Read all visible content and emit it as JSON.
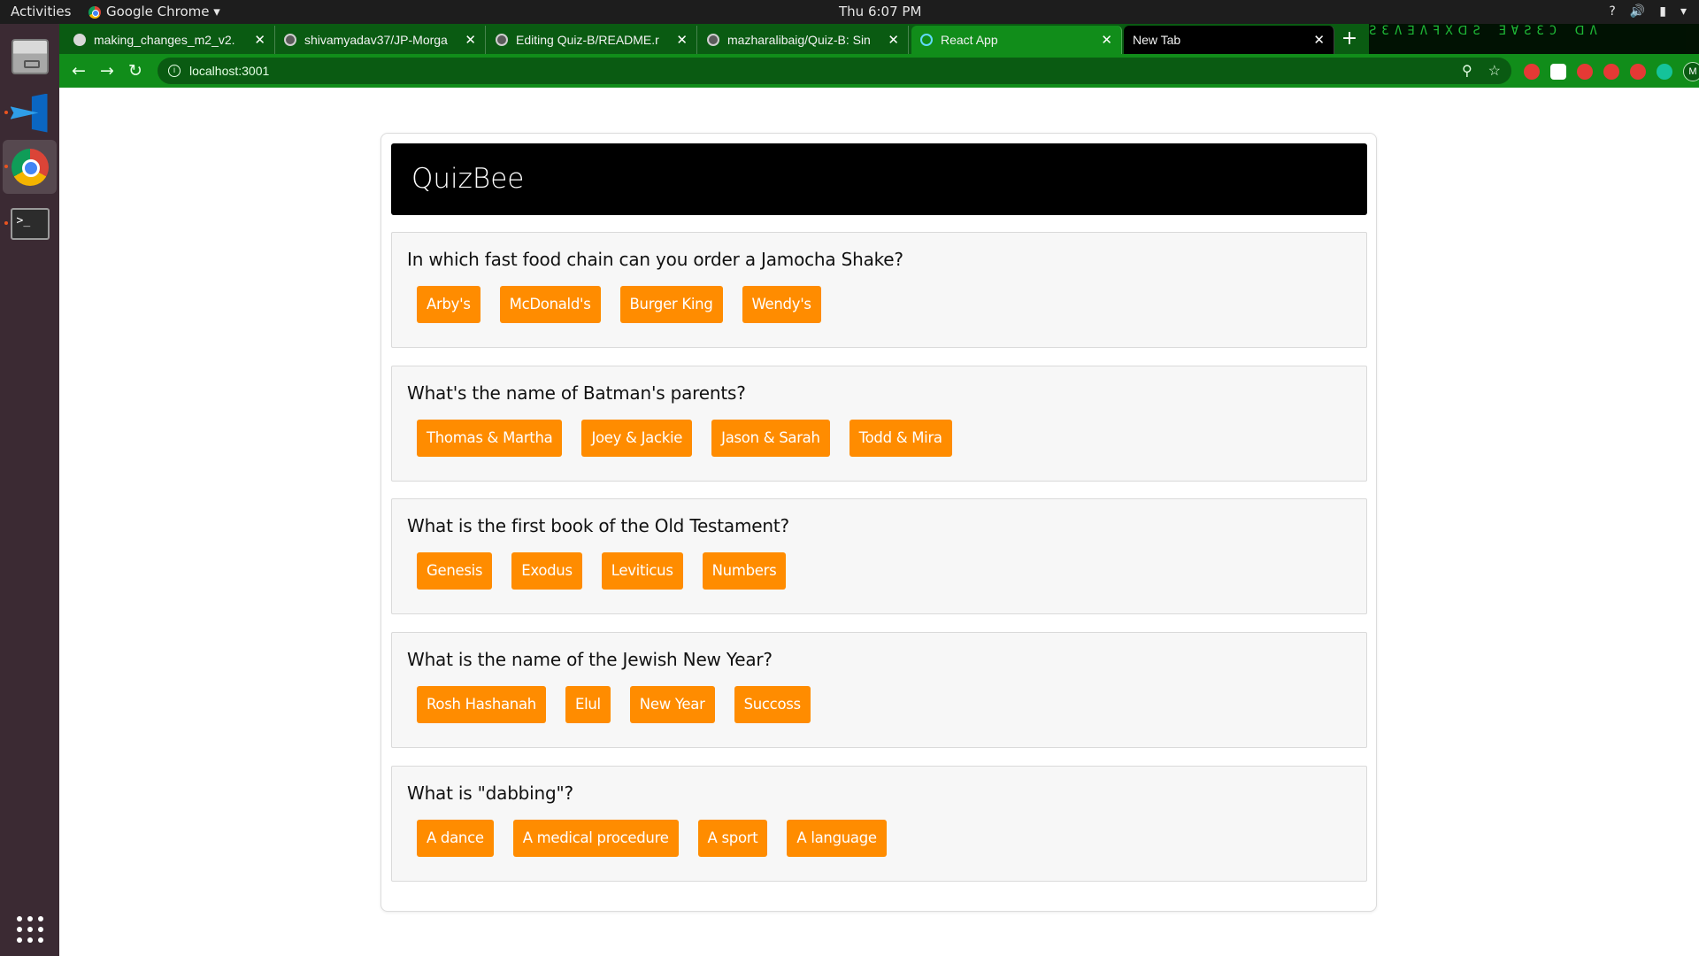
{
  "topbar": {
    "activities": "Activities",
    "app_name": "Google Chrome ▾",
    "clock": "Thu  6:07 PM",
    "tray": [
      "?",
      "🔊",
      "▮",
      "▾"
    ]
  },
  "dock": {
    "apps": [
      "Files",
      "Visual Studio Code",
      "Google Chrome",
      "Terminal",
      "Show Applications"
    ]
  },
  "browser": {
    "tabs": [
      {
        "label": "making_changes_m2_v2.",
        "icon": "globe-icon"
      },
      {
        "label": "shivamyadav37/JP-Morga",
        "icon": "github-icon"
      },
      {
        "label": "Editing Quiz-B/README.r",
        "icon": "github-icon"
      },
      {
        "label": "mazharalibaig/Quiz-B: Sin",
        "icon": "github-icon"
      },
      {
        "label": "React App",
        "icon": "react-icon"
      },
      {
        "label": "New Tab",
        "icon": ""
      }
    ],
    "new_tab": "+",
    "matrix_text": "ƧƐɅ∃ɅꟻXᗡƧ ƎⱯƧƐϽ ᗡɅ",
    "nav": {
      "back": "←",
      "forward": "→",
      "reload": "↻"
    },
    "url": "localhost:3001",
    "omnibox_icons": {
      "zoom": "⚲",
      "star": "☆"
    },
    "profile_initial": "M",
    "menu": "⋮"
  },
  "quiz": {
    "title": "QuizBee",
    "questions": [
      {
        "text": "In which fast food chain can you order a Jamocha Shake?",
        "answers": [
          "Arby's",
          "McDonald's",
          "Burger King",
          "Wendy's"
        ]
      },
      {
        "text": "What's the name of Batman's parents?",
        "answers": [
          "Thomas & Martha",
          "Joey & Jackie",
          "Jason & Sarah",
          "Todd & Mira"
        ]
      },
      {
        "text": "What is the first book of the Old Testament?",
        "answers": [
          "Genesis",
          "Exodus",
          "Leviticus",
          "Numbers"
        ]
      },
      {
        "text": "What is the name of the Jewish New Year?",
        "answers": [
          "Rosh Hashanah",
          "Elul",
          "New Year",
          "Succoss"
        ]
      },
      {
        "text": "What is \"dabbing\"?",
        "answers": [
          "A dance",
          "A medical procedure",
          "A sport",
          "A language"
        ]
      }
    ]
  },
  "colors": {
    "answer_button": "#ff8c00",
    "header_bg": "#000000",
    "browser_theme": "#118d1a",
    "dock_bg": "#3b2a33"
  }
}
